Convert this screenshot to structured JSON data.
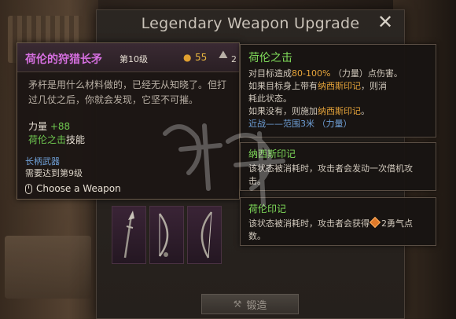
{
  "dialog": {
    "title": "Legendary Weapon Upgrade",
    "close_label": "✕"
  },
  "weapon_card": {
    "name": "荷伦的狩猎长矛",
    "level": "第10级",
    "coins": "55",
    "weight": "2",
    "description": "矛杆是用什么材料做的，已经无从知晓了。但打过几仗之后，你就会发现，它坚不可摧。",
    "stat_label": "力量",
    "stat_bonus": "+88",
    "skill_name": "荷伦之击",
    "skill_suffix": "技能",
    "weapon_type": "长柄武器",
    "requirement": "需要达到第9级",
    "choose_label": "Choose a Weapon"
  },
  "skill_panel": {
    "title": "荷伦之击",
    "line1_a": "对目标造成",
    "line1_b": "80-100%",
    "line1_c": " （力量）点伤害。",
    "line2_a": "如果目标身上带有",
    "line2_b": "纳西斯印记",
    "line2_c": "，则消",
    "line3": "耗此状态。",
    "line4_a": "如果没有，则施加",
    "line4_b": "纳西斯印记",
    "line4_c": "。",
    "line5": "近战——范围3米 （力量）"
  },
  "mark_panel": {
    "title": "纳西斯印记",
    "body": "该状态被消耗时，攻击者会发动一次借机攻击。"
  },
  "seal_panel": {
    "title": "荷伦印记",
    "body_a": "该状态被消耗时，攻击者会获得",
    "body_b": "2勇气点数。"
  },
  "forge": {
    "label": "锻造"
  },
  "slots": [
    {
      "name": "spear"
    },
    {
      "name": "bow"
    },
    {
      "name": "longbow"
    }
  ]
}
